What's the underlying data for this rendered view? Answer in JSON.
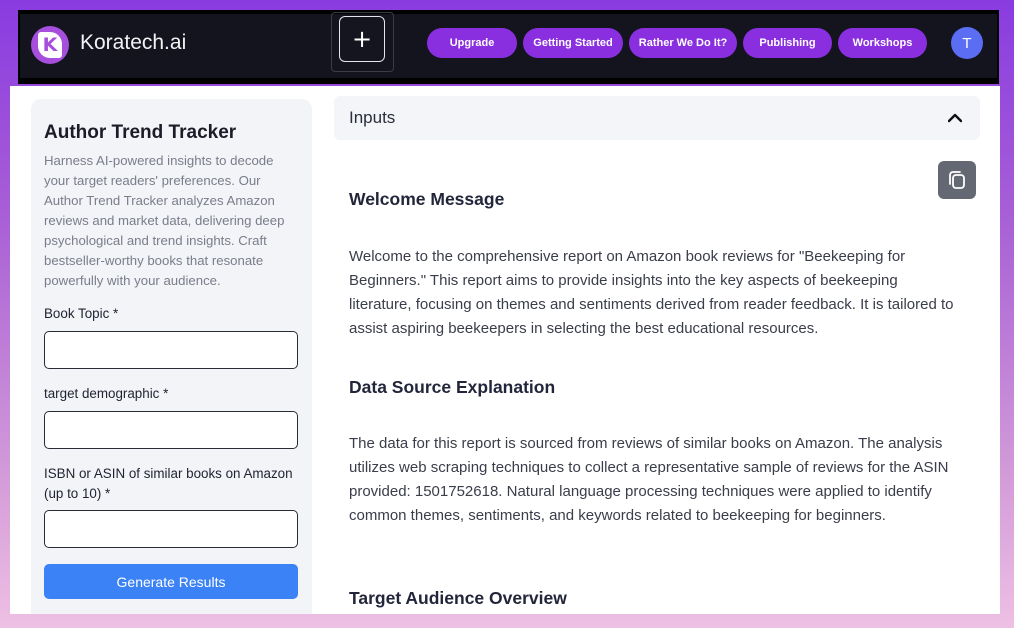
{
  "brand": {
    "name": "Koratech.ai",
    "logo_letter": "K"
  },
  "nav": {
    "plus_label": "+",
    "items": [
      {
        "label": "Upgrade"
      },
      {
        "label": "Getting Started"
      },
      {
        "label": "Rather We Do It?"
      },
      {
        "label": "Publishing"
      },
      {
        "label": "Workshops"
      }
    ],
    "avatar_letter": "T"
  },
  "sidebar": {
    "title": "Author Trend Tracker",
    "description": "Harness AI-powered insights to decode your target readers' preferences. Our Author Trend Tracker analyzes Amazon reviews and market data, delivering deep psychological and trend insights. Craft bestseller-worthy books that resonate powerfully with your audience.",
    "fields": [
      {
        "label": "Book Topic *",
        "value": ""
      },
      {
        "label": "target demographic *",
        "value": ""
      },
      {
        "label": "ISBN or ASIN of similar books on Amazon (up to 10) *",
        "value": ""
      }
    ],
    "generate_label": "Generate Results"
  },
  "inputs_panel": {
    "label": "Inputs"
  },
  "report": {
    "sections": [
      {
        "heading": "Welcome Message",
        "body": "Welcome to the comprehensive report on Amazon book reviews for \"Beekeeping for Beginners.\" This report aims to provide insights into the key aspects of beekeeping literature, focusing on themes and sentiments derived from reader feedback. It is tailored to assist aspiring beekeepers in selecting the best educational resources."
      },
      {
        "heading": "Data Source Explanation",
        "body": "The data for this report is sourced from reviews of similar books on Amazon. The analysis utilizes web scraping techniques to collect a representative sample of reviews for the ASIN provided: 1501752618. Natural language processing techniques were applied to identify common themes, sentiments, and keywords related to beekeeping for beginners."
      },
      {
        "heading": "Target Audience Overview",
        "body": ""
      }
    ]
  },
  "colors": {
    "accent_purple": "#8a2fe0",
    "button_blue": "#3b82f6",
    "avatar_blue": "#5b6df2",
    "topbar_bg": "#14141f"
  }
}
